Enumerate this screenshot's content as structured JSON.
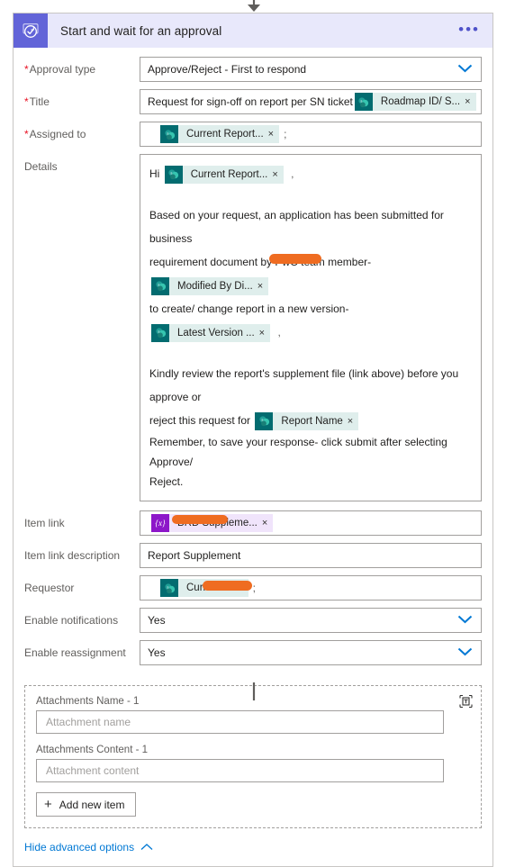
{
  "flow_card": {
    "header": {
      "icon": "approval-checkmark-icon",
      "title": "Start and wait for an approval",
      "overflow_label": "•••",
      "icon_bg_color": "#6264d8",
      "header_bg_color": "#e8e8fb"
    },
    "fields": {
      "approval_type": {
        "label": "Approval type",
        "required": true,
        "value": "Approve/Reject - First to respond",
        "control": "dropdown"
      },
      "title": {
        "label": "Title",
        "required": true,
        "text_prefix": "Request for sign-off on report per SN ticket",
        "token": {
          "label": "Roadmap ID/ S...",
          "icon": "sharepoint-icon",
          "remove": "×"
        }
      },
      "assigned_to": {
        "label": "Assigned to",
        "required": true,
        "token": {
          "label": "Current Report...",
          "icon": "sharepoint-icon",
          "remove": "×"
        },
        "separator": ";"
      },
      "details": {
        "label": "Details",
        "required": false,
        "line1_prefix": "Hi",
        "line1_token": {
          "label": "Current Report...",
          "icon": "sharepoint-icon",
          "remove": "×"
        },
        "line1_suffix": ",",
        "line2": "Based on your request, an application has been submitted for business",
        "line3_prefix": "requirement document by",
        "line3_redacted": true,
        "line3_mid": "team member-",
        "line3_token": {
          "label": "Modified By Di...",
          "icon": "sharepoint-icon",
          "remove": "×"
        },
        "line4_prefix": "to create/ change report in a new version-",
        "line4_token": {
          "label": "Latest Version ...",
          "icon": "sharepoint-icon",
          "remove": "×"
        },
        "line4_suffix": ",",
        "line5": "Kindly review the report's supplement file (link above) before you approve or",
        "line6_prefix": "reject this request for",
        "line6_token": {
          "label": "Report Name",
          "icon": "sharepoint-icon",
          "remove": "×"
        },
        "line7": "Remember, to save your response- click submit after selecting Approve/",
        "line8": "Reject."
      },
      "item_link": {
        "label": "Item link",
        "required": false,
        "token": {
          "label": "BRD Suppleme...",
          "icon": "variable-icon",
          "icon_glyph": "{x}",
          "remove": "×",
          "redacted": true
        }
      },
      "item_link_description": {
        "label": "Item link description",
        "required": false,
        "value": "Report Supplement"
      },
      "requestor": {
        "label": "Requestor",
        "required": false,
        "token": {
          "label": "Current ...",
          "icon": "sharepoint-icon",
          "remove": "×",
          "redacted": true
        },
        "separator": ";"
      },
      "enable_notifications": {
        "label": "Enable notifications",
        "required": false,
        "value": "Yes",
        "control": "dropdown"
      },
      "enable_reassignment": {
        "label": "Enable reassignment",
        "required": false,
        "value": "Yes",
        "control": "dropdown"
      }
    },
    "attachments": {
      "name_label": "Attachments Name - 1",
      "name_placeholder": "Attachment name",
      "content_label": "Attachments Content - 1",
      "content_placeholder": "Attachment content",
      "delete_icon": "trash-icon",
      "add_new_item_label": "Add new item",
      "add_new_item_icon": "plus-icon"
    },
    "footer": {
      "hide_advanced_label": "Hide advanced options",
      "caret_icon": "chevron-up-icon",
      "link_color": "#0078d4"
    }
  }
}
